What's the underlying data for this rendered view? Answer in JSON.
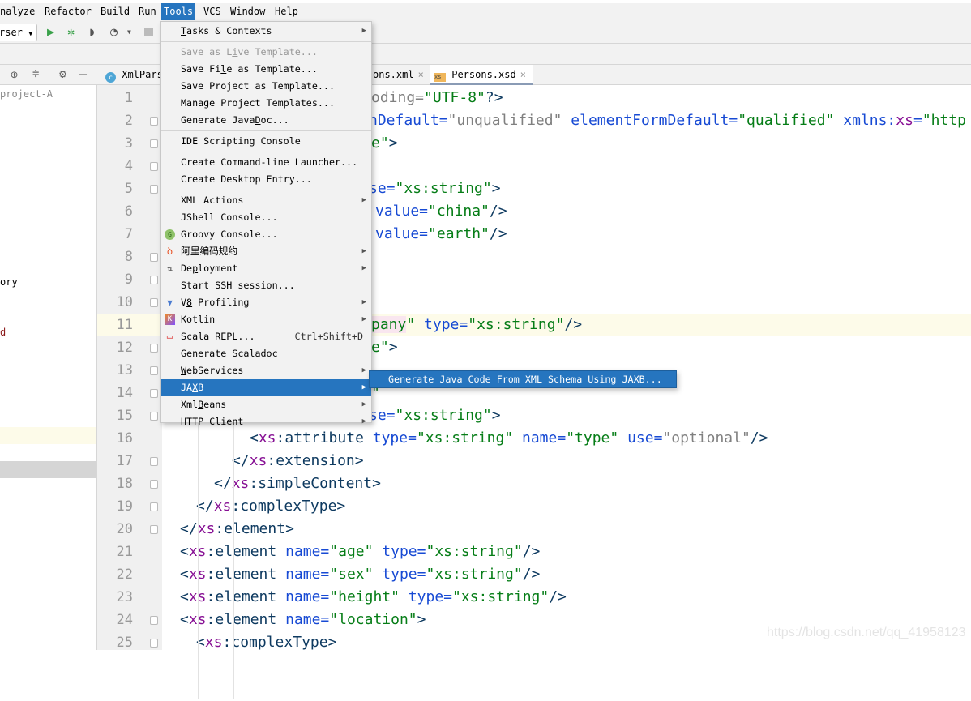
{
  "menubar": [
    {
      "label": "nalyze",
      "mnemonic": "z"
    },
    {
      "label": "Refactor",
      "mnemonic": "R"
    },
    {
      "label": "Build",
      "mnemonic": "B"
    },
    {
      "label": "Run",
      "mnemonic": "u"
    },
    {
      "label": "Tools",
      "mnemonic": "T",
      "active": true
    },
    {
      "label": "VCS",
      "mnemonic": "S"
    },
    {
      "label": "Window",
      "mnemonic": "W"
    },
    {
      "label": "Help",
      "mnemonic": "H"
    }
  ],
  "toolbar": {
    "run_config": "rser",
    "icons": [
      "run-icon",
      "debug-icon",
      "coverage-icon",
      "profile-icon",
      "stop-icon"
    ]
  },
  "project_panel": {
    "rows": [
      {
        "text": "project-A",
        "color": "#888888"
      },
      {
        "text": "ory",
        "color": "#000000"
      },
      {
        "text": "d",
        "color": "#8b1a1a"
      }
    ]
  },
  "tabs": [
    {
      "label": "XmlPars",
      "icon": "java-class-icon"
    },
    {
      "label": "ons.xml",
      "close": "×"
    },
    {
      "label": "Persons.xsd",
      "close": "×",
      "icon": "xsd-file-icon",
      "active": true
    }
  ],
  "gutter": {
    "line_numbers": [
      "1",
      "2",
      "3",
      "4",
      "5",
      "6",
      "7",
      "8",
      "9",
      "10",
      "11",
      "12",
      "13",
      "14",
      "15",
      "16",
      "17",
      "18",
      "19",
      "20",
      "21",
      "22",
      "23",
      "24",
      "25"
    ]
  },
  "code": [
    [
      [
        "def",
        "oding="
      ],
      [
        "val",
        "\"UTF-8\""
      ],
      [
        "br",
        "?>"
      ]
    ],
    [
      [
        "attr",
        "nDefault="
      ],
      [
        "def",
        "\"unqualified\""
      ],
      [
        "br",
        " "
      ],
      [
        "attr",
        "elementFormDefault="
      ],
      [
        "val",
        "\"qualified\""
      ],
      [
        "br",
        " "
      ],
      [
        "attr",
        "xmlns:"
      ],
      [
        "ns",
        "xs"
      ],
      [
        "attr",
        "="
      ],
      [
        "val",
        "\"http"
      ]
    ],
    [
      [
        "val",
        "e\""
      ],
      [
        "br",
        ">"
      ]
    ],
    [],
    [
      [
        "attr",
        "se="
      ],
      [
        "val",
        "\"xs:string\""
      ],
      [
        "br",
        ">"
      ]
    ],
    [
      [
        "attr",
        "value="
      ],
      [
        "val",
        "\"china\""
      ],
      [
        "br",
        "/>"
      ]
    ],
    [
      [
        "attr",
        "value="
      ],
      [
        "val",
        "\"earth\""
      ],
      [
        "br",
        "/>"
      ]
    ],
    [],
    [],
    [],
    [
      [
        "hl",
        "pany"
      ],
      [
        "val",
        "\""
      ],
      [
        "br",
        " "
      ],
      [
        "attr",
        "type="
      ],
      [
        "val",
        "\"xs:string\""
      ],
      [
        "br",
        "/>"
      ]
    ],
    [
      [
        "val",
        "e\""
      ],
      [
        "br",
        ">"
      ]
    ],
    [],
    [
      [
        "val",
        "\""
      ]
    ],
    [
      [
        "attr",
        "se="
      ],
      [
        "val",
        "\"xs:string\""
      ],
      [
        "br",
        ">"
      ]
    ],
    [
      [
        "br",
        "<"
      ],
      [
        "ns",
        "xs"
      ],
      [
        "tag",
        ":attribute "
      ],
      [
        "attr",
        "type="
      ],
      [
        "val",
        "\"xs:string\""
      ],
      [
        "br",
        " "
      ],
      [
        "attr",
        "name="
      ],
      [
        "val",
        "\"type\""
      ],
      [
        "br",
        " "
      ],
      [
        "attr",
        "use="
      ],
      [
        "def",
        "\"optional\""
      ],
      [
        "br",
        "/>"
      ]
    ],
    [
      [
        "br",
        "</"
      ],
      [
        "ns",
        "xs"
      ],
      [
        "tag",
        ":extension"
      ],
      [
        "br",
        ">"
      ]
    ],
    [
      [
        "br",
        "</"
      ],
      [
        "ns",
        "xs"
      ],
      [
        "tag",
        ":simpleContent"
      ],
      [
        "br",
        ">"
      ]
    ],
    [
      [
        "br",
        "</"
      ],
      [
        "ns",
        "xs"
      ],
      [
        "tag",
        ":complexType"
      ],
      [
        "br",
        ">"
      ]
    ],
    [
      [
        "br",
        "</"
      ],
      [
        "ns",
        "xs"
      ],
      [
        "tag",
        ":element"
      ],
      [
        "br",
        ">"
      ]
    ],
    [
      [
        "br",
        "<"
      ],
      [
        "ns",
        "xs"
      ],
      [
        "tag",
        ":element "
      ],
      [
        "attr",
        "name="
      ],
      [
        "val",
        "\"age\""
      ],
      [
        "br",
        " "
      ],
      [
        "attr",
        "type="
      ],
      [
        "val",
        "\"xs:string\""
      ],
      [
        "br",
        "/>"
      ]
    ],
    [
      [
        "br",
        "<"
      ],
      [
        "ns",
        "xs"
      ],
      [
        "tag",
        ":element "
      ],
      [
        "attr",
        "name="
      ],
      [
        "val",
        "\"sex\""
      ],
      [
        "br",
        " "
      ],
      [
        "attr",
        "type="
      ],
      [
        "val",
        "\"xs:string\""
      ],
      [
        "br",
        "/>"
      ]
    ],
    [
      [
        "br",
        "<"
      ],
      [
        "ns",
        "xs"
      ],
      [
        "tag",
        ":element "
      ],
      [
        "attr",
        "name="
      ],
      [
        "val",
        "\"height\""
      ],
      [
        "br",
        " "
      ],
      [
        "attr",
        "type="
      ],
      [
        "val",
        "\"xs:string\""
      ],
      [
        "br",
        "/>"
      ]
    ],
    [
      [
        "br",
        "<"
      ],
      [
        "ns",
        "xs"
      ],
      [
        "tag",
        ":element "
      ],
      [
        "attr",
        "name="
      ],
      [
        "val",
        "\"location\""
      ],
      [
        "br",
        ">"
      ]
    ],
    [
      [
        "br",
        "<"
      ],
      [
        "ns",
        "xs"
      ],
      [
        "tag",
        ":complexType"
      ],
      [
        "br",
        ">"
      ]
    ]
  ],
  "current_line": "11",
  "tools_menu": {
    "items": [
      {
        "label": "Tasks & Contexts",
        "mnemonic": "T",
        "submenu": true
      },
      {
        "sep": true
      },
      {
        "label": "Save as Live Template...",
        "mnemonic": "i",
        "disabled": true
      },
      {
        "label": "Save File as Template...",
        "mnemonic": "l"
      },
      {
        "label": "Save Project as Template..."
      },
      {
        "label": "Manage Project Templates..."
      },
      {
        "label": "Generate JavaDoc...",
        "mnemonic": "D"
      },
      {
        "sep": true
      },
      {
        "label": "IDE Scripting Console"
      },
      {
        "sep": true
      },
      {
        "label": "Create Command-line Launcher..."
      },
      {
        "label": "Create Desktop Entry..."
      },
      {
        "sep": true
      },
      {
        "label": "XML Actions",
        "submenu": true
      },
      {
        "label": "JShell Console..."
      },
      {
        "label": "Groovy Console...",
        "icon": "groovy-icon"
      },
      {
        "label": "阿里编码规约",
        "icon": "alibaba-icon",
        "submenu": true
      },
      {
        "label": "Deployment",
        "mnemonic": "p",
        "icon": "deployment-icon",
        "submenu": true
      },
      {
        "label": "Start SSH session..."
      },
      {
        "label": "V8 Profiling",
        "mnemonic": "8",
        "icon": "v8-icon",
        "submenu": true
      },
      {
        "label": "Kotlin",
        "icon": "kotlin-icon",
        "submenu": true
      },
      {
        "label": "Scala REPL...",
        "icon": "scala-repl-icon",
        "shortcut": "Ctrl+Shift+D"
      },
      {
        "label": "Generate Scaladoc"
      },
      {
        "label": "WebServices",
        "mnemonic": "W",
        "submenu": true
      },
      {
        "label": "JAXB",
        "mnemonic": "X",
        "submenu": true,
        "selected": true
      },
      {
        "label": "XmlBeans",
        "mnemonic": "B",
        "submenu": true
      },
      {
        "label": "HTTP Client",
        "submenu": true
      }
    ]
  },
  "jaxb_submenu": {
    "item": "Generate Java Code From XML Schema Using JAXB..."
  },
  "watermark": "https://blog.csdn.net/qq_41958123",
  "colors": {
    "accent": "#2675bf",
    "tag": "#0e3a60",
    "namespace": "#871094",
    "attribute": "#174ad4",
    "value": "#067d17",
    "default_value": "#808080",
    "current_line": "#fdfbe9"
  }
}
